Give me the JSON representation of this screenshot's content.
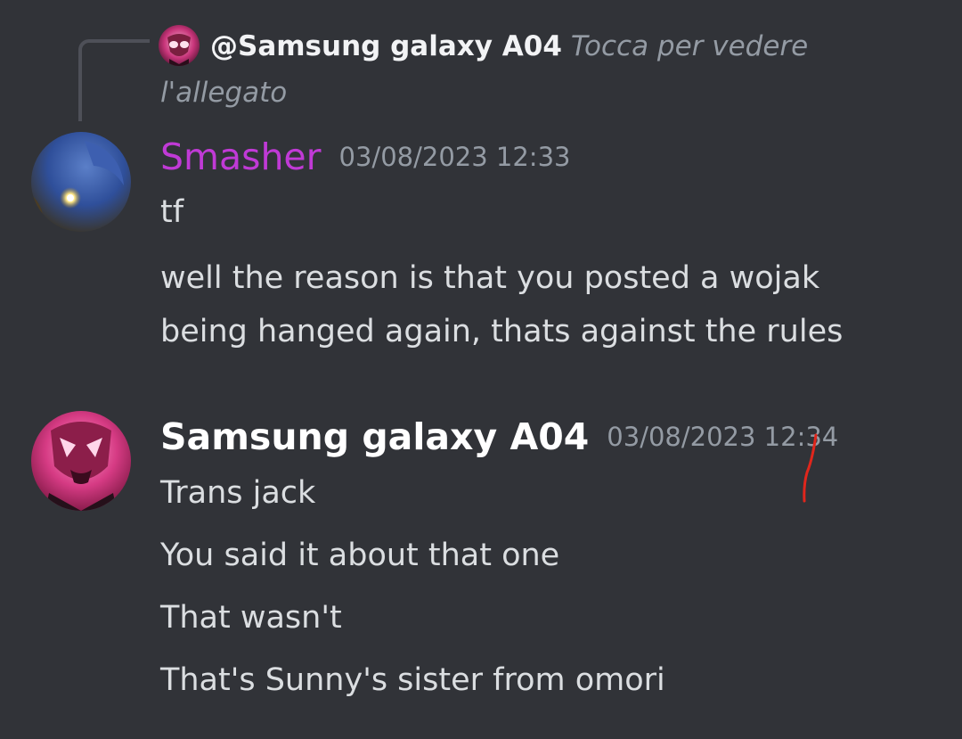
{
  "reply": {
    "author": "@Samsung galaxy A04",
    "attachment_text": "Tocca per vedere l'allegato",
    "avatar_icon": "pink-demon-avatar"
  },
  "messages": [
    {
      "author": "Smasher",
      "author_color": "#c03ad6",
      "timestamp": "03/08/2023 12:33",
      "avatar_icon": "blue-creature-avatar",
      "lines": [
        "tf",
        "well the reason is that you posted a wojak",
        "being hanged again, thats against the rules"
      ]
    },
    {
      "author": "Samsung galaxy A04",
      "author_color": "#ffffff",
      "timestamp": "03/08/2023 12:34",
      "avatar_icon": "pink-demon-avatar",
      "lines": [
        "Trans jack",
        "You said it about that one",
        "That wasn't",
        "That's Sunny's sister from omori"
      ]
    }
  ],
  "colors": {
    "background": "#313338",
    "text": "#dbdee1",
    "muted": "#949ba4",
    "annotation": "#e0261c"
  }
}
